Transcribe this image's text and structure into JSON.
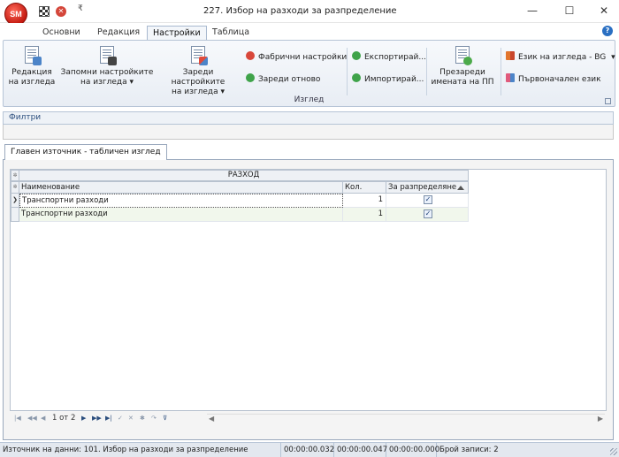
{
  "window": {
    "title": "227. Избор на разходи за разпределение",
    "logo_text": "SM",
    "minimize_glyph": "—",
    "maximize_glyph": "☐",
    "close_glyph": "✕",
    "qat_dropdown_glyph": "₹"
  },
  "tabs": [
    {
      "label": "Основни"
    },
    {
      "label": "Редакция"
    },
    {
      "label": "Настройки"
    },
    {
      "label": "Таблица"
    }
  ],
  "active_tab_index": 2,
  "help_glyph": "?",
  "ribbon": {
    "edit_view": {
      "line1": "Редакция",
      "line2": "на изгледа"
    },
    "save_view": {
      "line1": "Запомни настройките",
      "line2": "на изгледа ▾"
    },
    "load_view": {
      "line1": "Зареди настройките",
      "line2": "на изгледа ▾"
    },
    "factory_settings": "Фабрични настройки",
    "reload": "Зареди отново",
    "export": "Експортирай...",
    "import": "Импортирай...",
    "reload_names": {
      "line1": "Презареди",
      "line2": "имената на ПП"
    },
    "view_language": "Език на изгледа - BG",
    "view_language_dropdown_glyph": "▾",
    "original_language": "Първоначален език",
    "group_label": "Изглед"
  },
  "filters": {
    "label": "Филтри"
  },
  "main_tab": {
    "label": "Главен източник - табличен изглед"
  },
  "grid": {
    "band_header": "РАЗХОД",
    "columns": [
      {
        "label": "Наименование"
      },
      {
        "label": "Кол."
      },
      {
        "label": "За разпределяне",
        "sorted": "ascending"
      }
    ],
    "rows": [
      {
        "name": "Транспортни разходи",
        "qty": "1",
        "distribute": true,
        "indicator": "❯"
      },
      {
        "name": "Транспортни разходи",
        "qty": "1",
        "distribute": true,
        "indicator": ""
      }
    ],
    "indicator_header_glyph": "✲",
    "check_glyph": "✓"
  },
  "navigator": {
    "page_text": "1 от 2",
    "buttons": [
      "|◀",
      "◀◀",
      "◀",
      "▶",
      "▶▶",
      "▶|",
      "✓",
      "✕",
      "✱",
      "↷",
      "⊽"
    ],
    "scroll_left": "◀",
    "scroll_right": "▶"
  },
  "status": {
    "data_source": "Източник на данни: 101. Избор на разходи за разпределение",
    "time1": "00:00:00.032",
    "time2": "00:00:00.047",
    "time3": "00:00:00.000",
    "records": "Брой записи: 2"
  }
}
